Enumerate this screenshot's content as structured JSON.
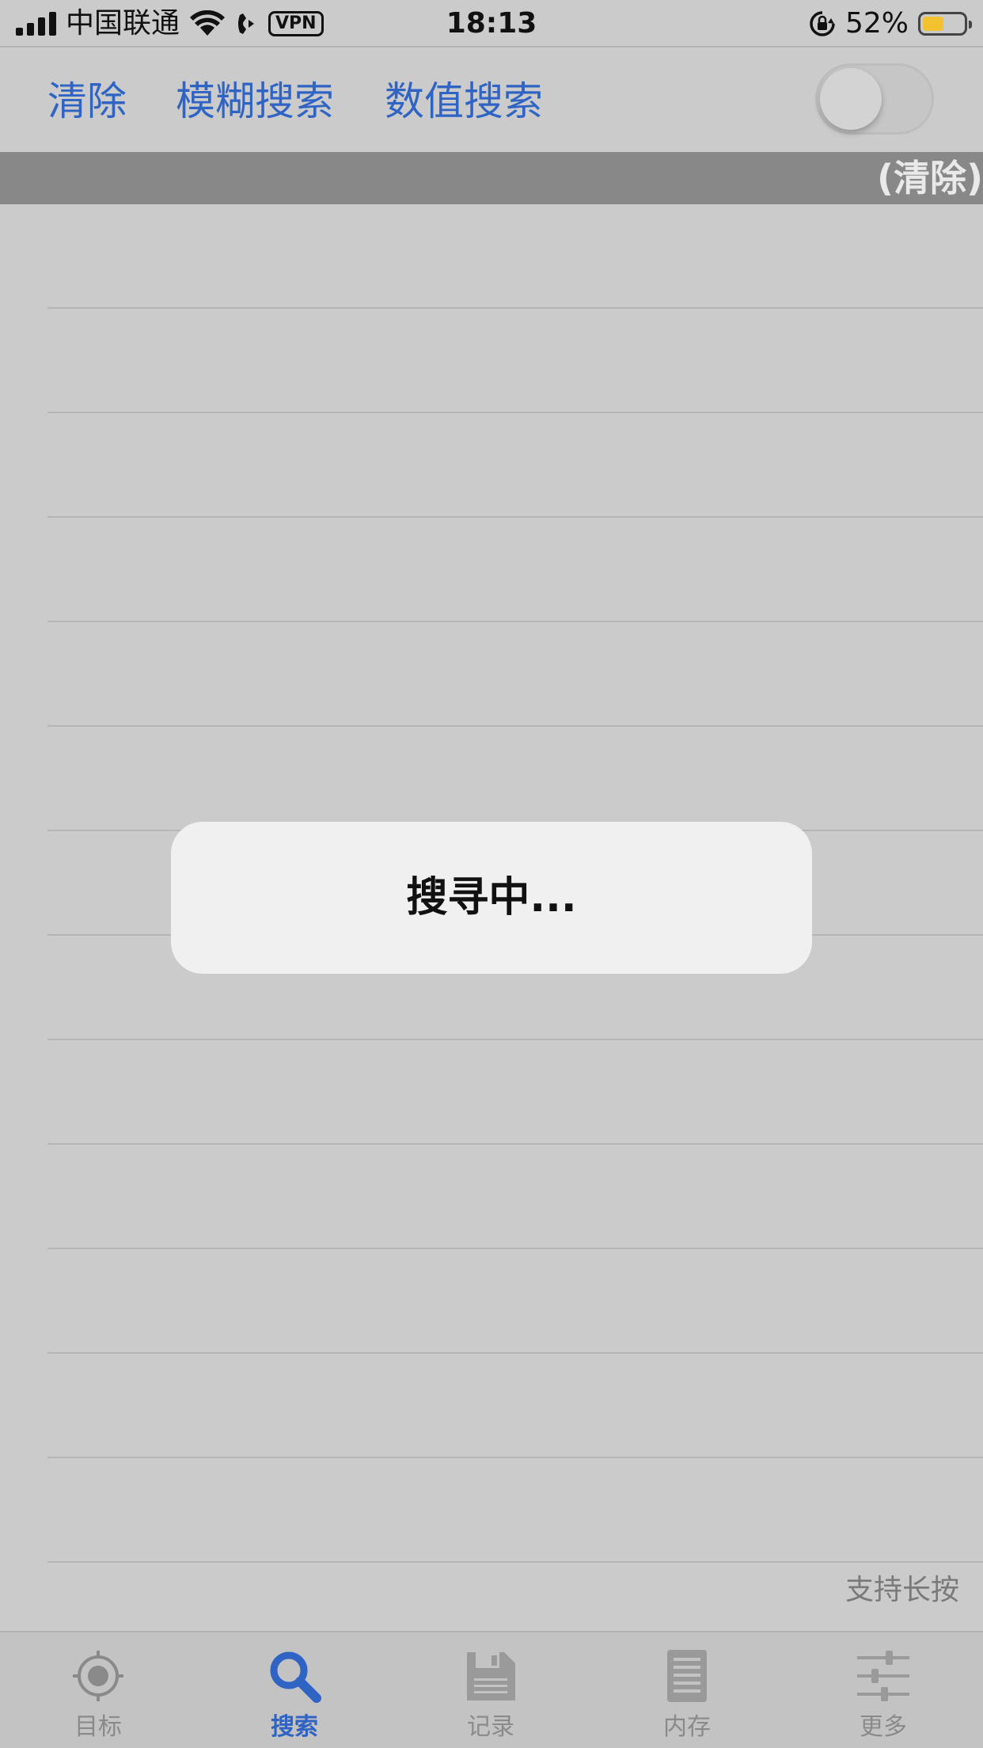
{
  "status_bar": {
    "carrier": "中国联通",
    "vpn": "VPN",
    "time": "18:13",
    "battery_percent_label": "52%",
    "battery_level": 0.52,
    "battery_color": "#f2c230"
  },
  "toolbar": {
    "clear_label": "清除",
    "fuzzy_search_label": "模糊搜索",
    "value_search_label": "数值搜索",
    "toggle_on": false
  },
  "result_header": {
    "clear_label": "(清除)"
  },
  "hud": {
    "message": "搜寻中..."
  },
  "hint": "支持长按",
  "tab_bar": {
    "active_color": "#2f64c5",
    "tabs": [
      {
        "label": "目标",
        "icon": "target-icon"
      },
      {
        "label": "搜索",
        "icon": "search-icon",
        "active": true
      },
      {
        "label": "记录",
        "icon": "save-icon"
      },
      {
        "label": "内存",
        "icon": "memory-icon"
      },
      {
        "label": "更多",
        "icon": "sliders-icon"
      }
    ]
  }
}
